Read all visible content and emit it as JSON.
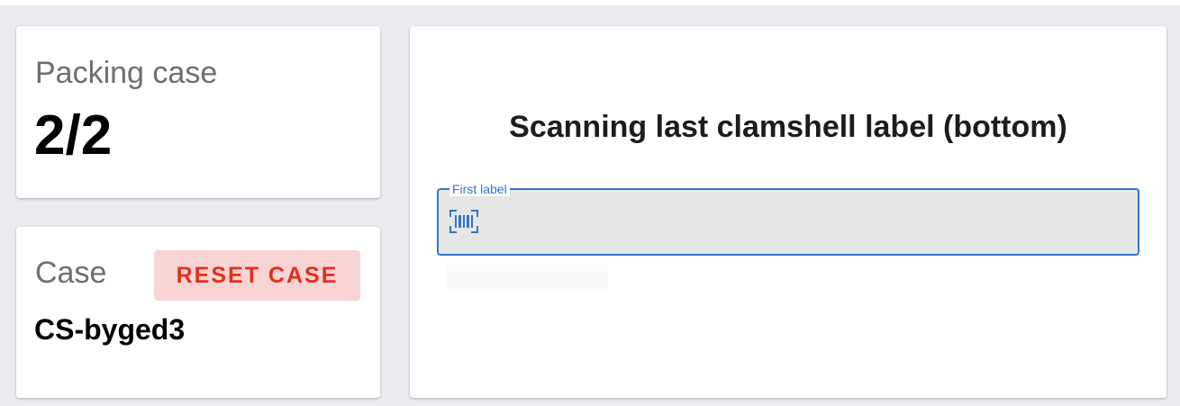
{
  "packing": {
    "label": "Packing case",
    "value": "2/2"
  },
  "case": {
    "label": "Case",
    "id": "CS-byged3",
    "reset_label": "RESET CASE"
  },
  "scan": {
    "title": "Scanning last clamshell label (bottom)",
    "field_label": "First label",
    "field_value": "",
    "icon": "barcode-scan-icon"
  },
  "colors": {
    "background": "#ebebf0",
    "accent": "#2f76c8",
    "reset_text": "#e0301e",
    "reset_background": "#f9d4d4"
  }
}
